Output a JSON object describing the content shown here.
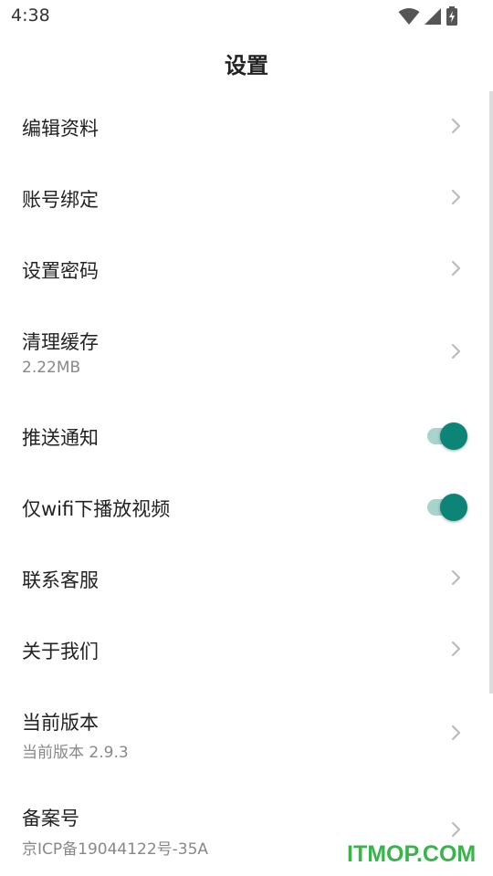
{
  "status_bar": {
    "time": "4:38",
    "icons": [
      "wifi-icon",
      "cell-signal-icon",
      "battery-charging-icon"
    ]
  },
  "header": {
    "title": "设置"
  },
  "settings": {
    "edit_profile": {
      "label": "编辑资料"
    },
    "account_binding": {
      "label": "账号绑定"
    },
    "set_password": {
      "label": "设置密码"
    },
    "clear_cache": {
      "label": "清理缓存",
      "sub": "2.22MB"
    },
    "push_notifications": {
      "label": "推送通知",
      "enabled": true
    },
    "wifi_only_video": {
      "label": "仅wifi下播放视频",
      "enabled": true
    },
    "contact_support": {
      "label": "联系客服"
    },
    "about_us": {
      "label": "关于我们"
    },
    "current_version": {
      "label": "当前版本",
      "sub": "当前版本 2.9.3"
    },
    "icp_record": {
      "label": "备案号",
      "sub": "京ICP备19044122号-35A"
    }
  },
  "colors": {
    "toggle_on": "#0c8577",
    "toggle_track": "#a9d3cd",
    "chevron": "#bbbbbb",
    "watermark": "#37b54a"
  },
  "watermark": {
    "text": "ITMOP.COM"
  }
}
